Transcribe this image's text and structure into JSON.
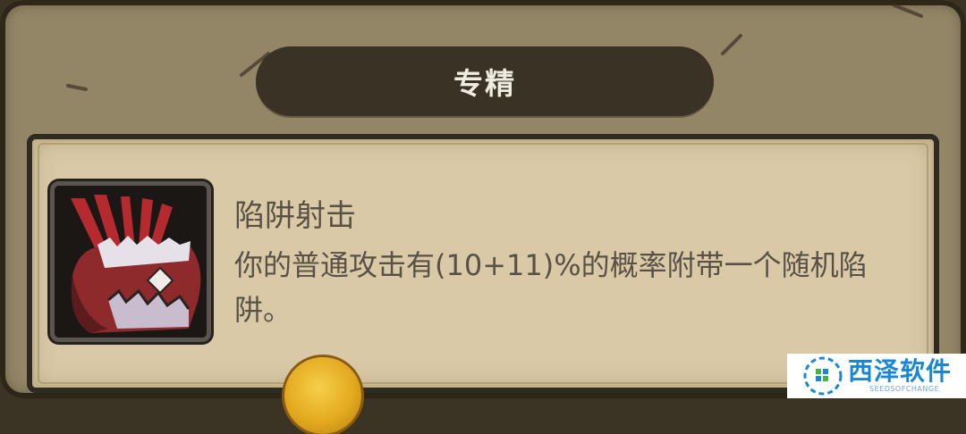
{
  "header": {
    "title": "专精"
  },
  "skill": {
    "icon": "trap-jaw-icon",
    "name": "陷阱射击",
    "description": "你的普通攻击有(10+11)%的概率附带一个随机陷阱。"
  },
  "watermark": {
    "main": "西泽软件",
    "sub": "SEEDSOFCHANGE"
  },
  "colors": {
    "panel": "#938667",
    "title_pill": "#3b3226",
    "parchment": "#d9c9a6",
    "text": "#5a5146",
    "icon_red": "#9e2a2e",
    "coin": "#e3a91e",
    "watermark_blue": "#1a86d6"
  }
}
